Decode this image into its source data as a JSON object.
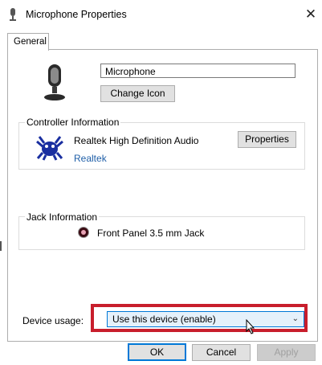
{
  "window": {
    "title": "Microphone Properties",
    "close_symbol": "✕"
  },
  "tabs": [
    {
      "label": "General",
      "active": true
    }
  ],
  "device": {
    "name": "Microphone",
    "change_icon_label": "Change Icon"
  },
  "controller": {
    "group_label": "Controller Information",
    "driver_name": "Realtek High Definition Audio",
    "vendor": "Realtek",
    "properties_label": "Properties"
  },
  "jack": {
    "group_label": "Jack Information",
    "description": "Front Panel 3.5 mm Jack",
    "jack_color": "#e7a3b4"
  },
  "usage": {
    "label": "Device usage:",
    "selected": "Use this device (enable)",
    "highlight_color": "#c81e2c"
  },
  "footer": {
    "ok": "OK",
    "cancel": "Cancel",
    "apply": "Apply"
  },
  "icons": {
    "title": "microphone-icon",
    "device": "microphone-icon",
    "controller": "realtek-crab-icon",
    "jack": "audio-jack-icon",
    "dropdown": "chevron-down-icon",
    "close": "close-icon",
    "pointer": "mouse-cursor-icon"
  }
}
